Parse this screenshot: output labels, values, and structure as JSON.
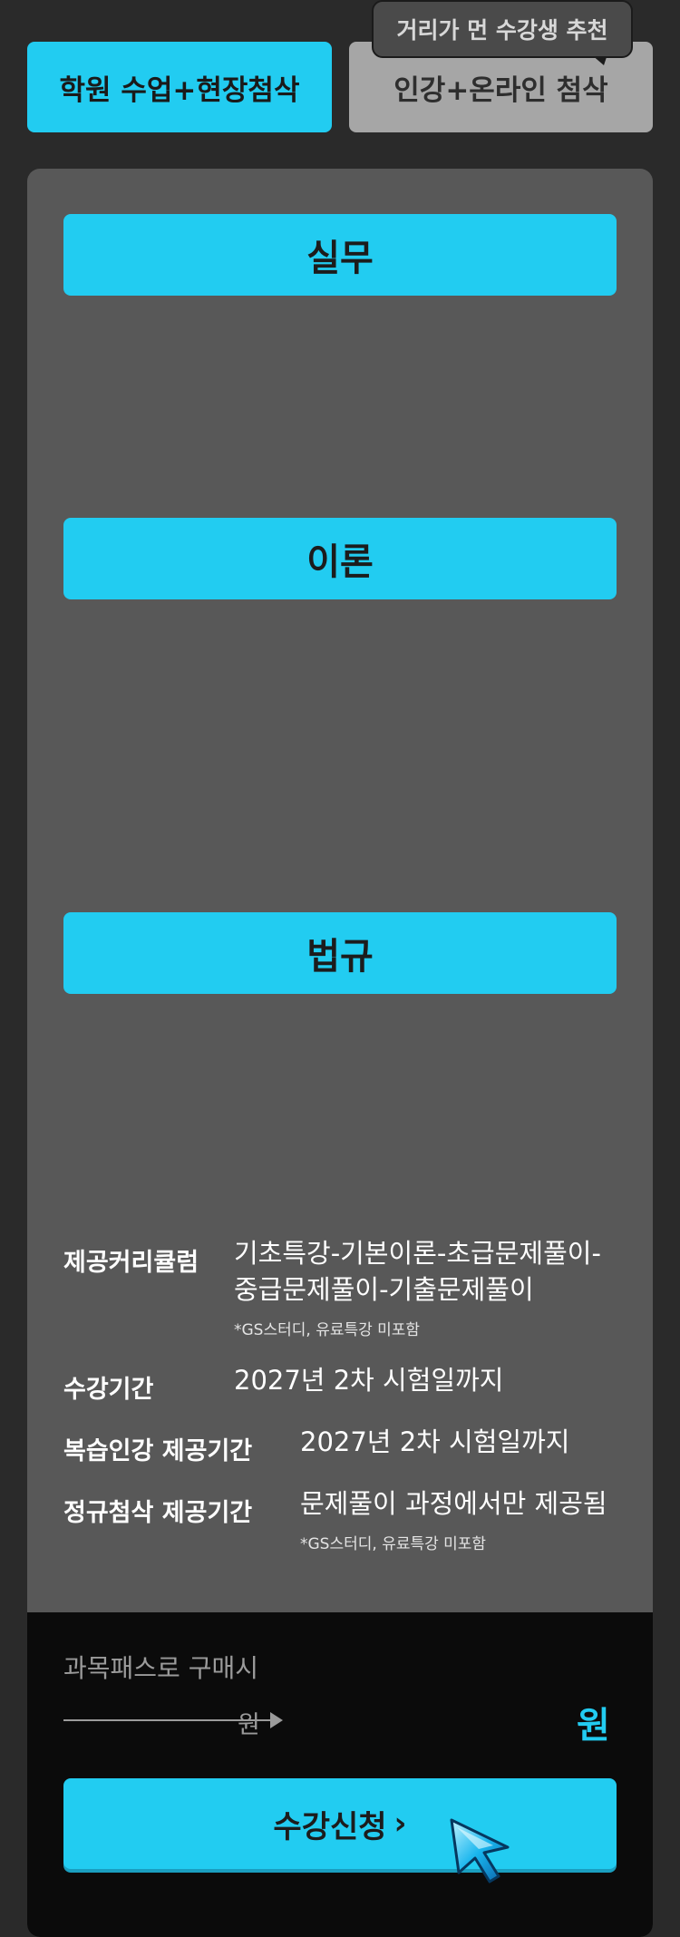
{
  "tabs": {
    "academy_label": "학원 수업+현장첨삭",
    "online_label": "인강+온라인 첨삭",
    "tooltip": "거리가 먼 수강생 추천"
  },
  "sections": {
    "practice": "실무",
    "theory": "이론",
    "law": "법규"
  },
  "info": {
    "curriculum_label": "제공커리큘럼",
    "curriculum_line1": "기초특강-기본이론-초급문제풀이-",
    "curriculum_line2": "중급문제풀이-기출문제풀이",
    "curriculum_note": "*GS스터디, 유료특강 미포함",
    "period_label": "수강기간",
    "period_value": "2027년 2차 시험일까지",
    "review_label": "복습인강 제공기간",
    "review_value": "2027년 2차 시험일까지",
    "feedback_label": "정규첨삭 제공기간",
    "feedback_value": "문제풀이 과정에서만 제공됨",
    "feedback_note": "*GS스터디, 유료특강 미포함"
  },
  "purchase": {
    "caption": "과목패스로 구매시",
    "original_unit": "원",
    "price_unit": "원",
    "apply_label": "수강신청",
    "apply_chevron": "›"
  },
  "colors": {
    "accent": "#22ccf1",
    "background": "#2a2a2a",
    "panel": "#585858",
    "footer": "#0b0b0b"
  }
}
